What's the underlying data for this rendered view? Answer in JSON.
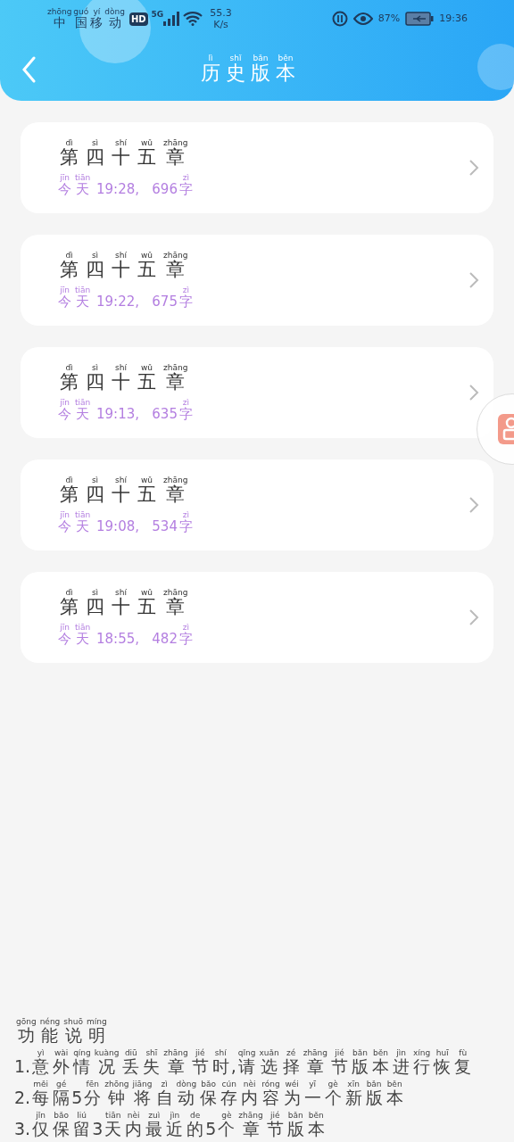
{
  "status_bar": {
    "carrier": [
      {
        "pinyin": "zhōng",
        "text": "中"
      },
      {
        "pinyin": "guó",
        "text": "国"
      },
      {
        "pinyin": "yí",
        "text": "移"
      },
      {
        "pinyin": "dòng",
        "text": "动"
      }
    ],
    "hd": "HD",
    "network": "5G",
    "speed": "55.3",
    "speed_unit": "K/s",
    "battery_percent": "87%",
    "time": "19:36"
  },
  "header": {
    "title": [
      {
        "pinyin": "lì",
        "text": "历"
      },
      {
        "pinyin": "shǐ",
        "text": "史"
      },
      {
        "pinyin": "bǎn",
        "text": "版"
      },
      {
        "pinyin": "běn",
        "text": "本"
      }
    ]
  },
  "versions": [
    {
      "chapter": [
        {
          "pinyin": "dì",
          "text": "第"
        },
        {
          "pinyin": "sì",
          "text": "四"
        },
        {
          "pinyin": "shí",
          "text": "十"
        },
        {
          "pinyin": "wǔ",
          "text": "五"
        },
        {
          "pinyin": "zhāng",
          "text": "章"
        }
      ],
      "meta": [
        {
          "pinyin": "jīn",
          "text": "今"
        },
        {
          "pinyin": "tiān",
          "text": "天"
        },
        {
          "text": " 19:28,   696"
        },
        {
          "pinyin": "zì",
          "text": "字"
        }
      ]
    },
    {
      "chapter": [
        {
          "pinyin": "dì",
          "text": "第"
        },
        {
          "pinyin": "sì",
          "text": "四"
        },
        {
          "pinyin": "shí",
          "text": "十"
        },
        {
          "pinyin": "wǔ",
          "text": "五"
        },
        {
          "pinyin": "zhāng",
          "text": "章"
        }
      ],
      "meta": [
        {
          "pinyin": "jīn",
          "text": "今"
        },
        {
          "pinyin": "tiān",
          "text": "天"
        },
        {
          "text": " 19:22,   675"
        },
        {
          "pinyin": "zì",
          "text": "字"
        }
      ]
    },
    {
      "chapter": [
        {
          "pinyin": "dì",
          "text": "第"
        },
        {
          "pinyin": "sì",
          "text": "四"
        },
        {
          "pinyin": "shí",
          "text": "十"
        },
        {
          "pinyin": "wǔ",
          "text": "五"
        },
        {
          "pinyin": "zhāng",
          "text": "章"
        }
      ],
      "meta": [
        {
          "pinyin": "jīn",
          "text": "今"
        },
        {
          "pinyin": "tiān",
          "text": "天"
        },
        {
          "text": " 19:13,   635"
        },
        {
          "pinyin": "zì",
          "text": "字"
        }
      ]
    },
    {
      "chapter": [
        {
          "pinyin": "dì",
          "text": "第"
        },
        {
          "pinyin": "sì",
          "text": "四"
        },
        {
          "pinyin": "shí",
          "text": "十"
        },
        {
          "pinyin": "wǔ",
          "text": "五"
        },
        {
          "pinyin": "zhāng",
          "text": "章"
        }
      ],
      "meta": [
        {
          "pinyin": "jīn",
          "text": "今"
        },
        {
          "pinyin": "tiān",
          "text": "天"
        },
        {
          "text": " 19:08,   534"
        },
        {
          "pinyin": "zì",
          "text": "字"
        }
      ]
    },
    {
      "chapter": [
        {
          "pinyin": "dì",
          "text": "第"
        },
        {
          "pinyin": "sì",
          "text": "四"
        },
        {
          "pinyin": "shí",
          "text": "十"
        },
        {
          "pinyin": "wǔ",
          "text": "五"
        },
        {
          "pinyin": "zhāng",
          "text": "章"
        }
      ],
      "meta": [
        {
          "pinyin": "jīn",
          "text": "今"
        },
        {
          "pinyin": "tiān",
          "text": "天"
        },
        {
          "text": " 18:55,   482"
        },
        {
          "pinyin": "zì",
          "text": "字"
        }
      ]
    }
  ],
  "help": {
    "title": [
      {
        "pinyin": "gōng",
        "text": "功"
      },
      {
        "pinyin": "néng",
        "text": "能"
      },
      {
        "pinyin": "shuō",
        "text": "说"
      },
      {
        "pinyin": "míng",
        "text": "明"
      }
    ],
    "lines": [
      [
        {
          "text": "1."
        },
        {
          "pinyin": "yì",
          "text": "意"
        },
        {
          "pinyin": "wài",
          "text": "外"
        },
        {
          "pinyin": "qíng",
          "text": "情"
        },
        {
          "pinyin": "kuàng",
          "text": "况"
        },
        {
          "pinyin": "diū",
          "text": "丢"
        },
        {
          "pinyin": "shī",
          "text": "失"
        },
        {
          "pinyin": "zhāng",
          "text": "章"
        },
        {
          "pinyin": "jié",
          "text": "节"
        },
        {
          "pinyin": "shí",
          "text": "时"
        },
        {
          "text": ","
        },
        {
          "pinyin": "qǐng",
          "text": "请"
        },
        {
          "pinyin": "xuǎn",
          "text": "选"
        },
        {
          "pinyin": "zé",
          "text": "择"
        },
        {
          "pinyin": "zhāng",
          "text": "章"
        },
        {
          "pinyin": "jié",
          "text": "节"
        },
        {
          "pinyin": "bǎn",
          "text": "版"
        },
        {
          "pinyin": "běn",
          "text": "本"
        },
        {
          "pinyin": "jìn",
          "text": "进"
        },
        {
          "pinyin": "xíng",
          "text": "行"
        },
        {
          "pinyin": "huī",
          "text": "恢"
        },
        {
          "pinyin": "fù",
          "text": "复"
        }
      ],
      [
        {
          "text": "2."
        },
        {
          "pinyin": "měi",
          "text": "每"
        },
        {
          "pinyin": "gé",
          "text": "隔"
        },
        {
          "text": "5"
        },
        {
          "pinyin": "fēn",
          "text": "分"
        },
        {
          "pinyin": "zhōng",
          "text": "钟"
        },
        {
          "pinyin": "jiāng",
          "text": "将"
        },
        {
          "pinyin": "zì",
          "text": "自"
        },
        {
          "pinyin": "dòng",
          "text": "动"
        },
        {
          "pinyin": "bǎo",
          "text": "保"
        },
        {
          "pinyin": "cún",
          "text": "存"
        },
        {
          "pinyin": "nèi",
          "text": "内"
        },
        {
          "pinyin": "róng",
          "text": "容"
        },
        {
          "pinyin": "wéi",
          "text": "为"
        },
        {
          "pinyin": "yī",
          "text": "一"
        },
        {
          "pinyin": "gè",
          "text": "个"
        },
        {
          "pinyin": "xīn",
          "text": "新"
        },
        {
          "pinyin": "bǎn",
          "text": "版"
        },
        {
          "pinyin": "běn",
          "text": "本"
        }
      ],
      [
        {
          "text": "3."
        },
        {
          "pinyin": "jǐn",
          "text": "仅"
        },
        {
          "pinyin": "bǎo",
          "text": "保"
        },
        {
          "pinyin": "liú",
          "text": "留"
        },
        {
          "text": "3"
        },
        {
          "pinyin": "tiān",
          "text": "天"
        },
        {
          "pinyin": "nèi",
          "text": "内"
        },
        {
          "pinyin": "zuì",
          "text": "最"
        },
        {
          "pinyin": "jìn",
          "text": "近"
        },
        {
          "pinyin": "de",
          "text": "的"
        },
        {
          "text": "5"
        },
        {
          "pinyin": "gè",
          "text": "个"
        },
        {
          "pinyin": "zhāng",
          "text": "章"
        },
        {
          "pinyin": "jié",
          "text": "节"
        },
        {
          "pinyin": "bǎn",
          "text": "版"
        },
        {
          "pinyin": "běn",
          "text": "本"
        }
      ]
    ]
  }
}
